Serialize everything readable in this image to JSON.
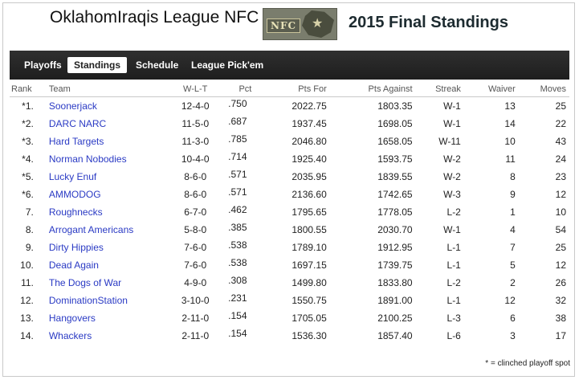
{
  "header": {
    "league_title": "OklahomIraqis League NFC",
    "logo_text": "NFC",
    "season_title": "2015 Final Standings"
  },
  "nav": {
    "tabs": [
      "Playoffs",
      "Standings",
      "Schedule",
      "League Pick'em"
    ],
    "active": "Standings"
  },
  "table": {
    "columns": [
      "Rank",
      "Team",
      "W-L-T",
      "Pct",
      "Pts For",
      "Pts Against",
      "Streak",
      "Waiver",
      "Moves"
    ],
    "rows": [
      {
        "rank": "*1.",
        "team": "Soonerjack",
        "wlt": "12-4-0",
        "pct": ".750",
        "pf": "2022.75",
        "pa": "1803.35",
        "streak": "W-1",
        "waiver": "13",
        "moves": "25"
      },
      {
        "rank": "*2.",
        "team": "DARC NARC",
        "wlt": "11-5-0",
        "pct": ".687",
        "pf": "1937.45",
        "pa": "1698.05",
        "streak": "W-1",
        "waiver": "14",
        "moves": "22"
      },
      {
        "rank": "*3.",
        "team": "Hard Targets",
        "wlt": "11-3-0",
        "pct": ".785",
        "pf": "2046.80",
        "pa": "1658.05",
        "streak": "W-11",
        "waiver": "10",
        "moves": "43"
      },
      {
        "rank": "*4.",
        "team": "Norman Nobodies",
        "wlt": "10-4-0",
        "pct": ".714",
        "pf": "1925.40",
        "pa": "1593.75",
        "streak": "W-2",
        "waiver": "11",
        "moves": "24"
      },
      {
        "rank": "*5.",
        "team": "Lucky Enuf",
        "wlt": "8-6-0",
        "pct": ".571",
        "pf": "2035.95",
        "pa": "1839.55",
        "streak": "W-2",
        "waiver": "8",
        "moves": "23"
      },
      {
        "rank": "*6.",
        "team": "AMMODOG",
        "wlt": "8-6-0",
        "pct": ".571",
        "pf": "2136.60",
        "pa": "1742.65",
        "streak": "W-3",
        "waiver": "9",
        "moves": "12"
      },
      {
        "rank": "7.",
        "team": "Roughnecks",
        "wlt": "6-7-0",
        "pct": ".462",
        "pf": "1795.65",
        "pa": "1778.05",
        "streak": "L-2",
        "waiver": "1",
        "moves": "10"
      },
      {
        "rank": "8.",
        "team": "Arrogant Americans",
        "wlt": "5-8-0",
        "pct": ".385",
        "pf": "1800.55",
        "pa": "2030.70",
        "streak": "W-1",
        "waiver": "4",
        "moves": "54"
      },
      {
        "rank": "9.",
        "team": "Dirty Hippies",
        "wlt": "7-6-0",
        "pct": ".538",
        "pf": "1789.10",
        "pa": "1912.95",
        "streak": "L-1",
        "waiver": "7",
        "moves": "25"
      },
      {
        "rank": "10.",
        "team": "Dead Again",
        "wlt": "7-6-0",
        "pct": ".538",
        "pf": "1697.15",
        "pa": "1739.75",
        "streak": "L-1",
        "waiver": "5",
        "moves": "12"
      },
      {
        "rank": "11.",
        "team": "The Dogs of War",
        "wlt": "4-9-0",
        "pct": ".308",
        "pf": "1499.80",
        "pa": "1833.80",
        "streak": "L-2",
        "waiver": "2",
        "moves": "26"
      },
      {
        "rank": "12.",
        "team": "DominationStation",
        "wlt": "3-10-0",
        "pct": ".231",
        "pf": "1550.75",
        "pa": "1891.00",
        "streak": "L-1",
        "waiver": "12",
        "moves": "32"
      },
      {
        "rank": "13.",
        "team": "Hangovers",
        "wlt": "2-11-0",
        "pct": ".154",
        "pf": "1705.05",
        "pa": "2100.25",
        "streak": "L-3",
        "waiver": "6",
        "moves": "38"
      },
      {
        "rank": "14.",
        "team": "Whackers",
        "wlt": "2-11-0",
        "pct": ".154",
        "pf": "1536.30",
        "pa": "1857.40",
        "streak": "L-6",
        "waiver": "3",
        "moves": "17"
      }
    ]
  },
  "footnote": "* = clinched playoff spot"
}
